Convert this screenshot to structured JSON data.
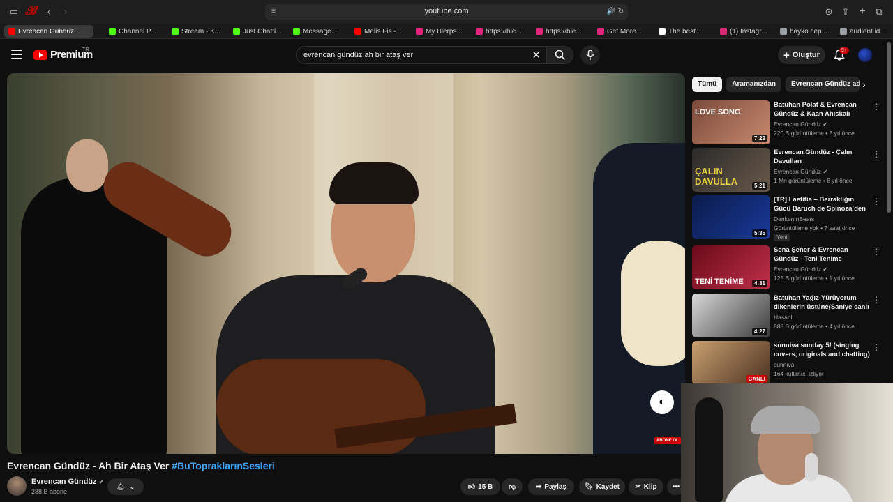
{
  "browser": {
    "url": "youtube.com",
    "tabs": [
      {
        "label": "Evrencan Gündüz...",
        "color": "#ff0000",
        "active": true
      },
      {
        "label": "Channel P...",
        "color": "#53fc18"
      },
      {
        "label": "Stream - K...",
        "color": "#53fc18"
      },
      {
        "label": "Just Chatti...",
        "color": "#53fc18"
      },
      {
        "label": "Message...",
        "color": "#53fc18"
      },
      {
        "label": "Melis Fis -...",
        "color": "#ff0000"
      },
      {
        "label": "My Blerps...",
        "color": "#e0267d"
      },
      {
        "label": "https://ble...",
        "color": "#e0267d"
      },
      {
        "label": "https://ble...",
        "color": "#e0267d"
      },
      {
        "label": "Get More...",
        "color": "#e0267d"
      },
      {
        "label": "The best...",
        "color": "#ffffff"
      },
      {
        "label": "(1) Instagr...",
        "color": "#d62976"
      },
      {
        "label": "hayko cep...",
        "color": "#9aa0a6"
      },
      {
        "label": "audient id...",
        "color": "#9aa0a6"
      }
    ]
  },
  "header": {
    "logo_text": "Premium",
    "logo_region": "TR",
    "search_value": "evrencan gündüz ah bir ataş ver",
    "create_label": "Oluştur",
    "notif_count": "9+"
  },
  "video": {
    "title_main": "Evrencan Gündüz - Ah Bir Ataş Ver ",
    "title_hashtag": "#BuTopraklarınSesleri",
    "overlay_sub": "ABONE OL",
    "channel_name": "Evrencan Gündüz",
    "subscribers": "288 B abone",
    "likes": "15 B",
    "share_label": "Paylaş",
    "save_label": "Kaydet",
    "clip_label": "Klip"
  },
  "chips": [
    "Tümü",
    "Aramanızdan",
    "Evrencan Gündüz adlı yü"
  ],
  "recommendations": [
    {
      "title": "Batuhan Polat & Evrencan Gündüz & Kaan Ahıskalı - Love ...",
      "channel": "Evrencan Gündüz",
      "verified": true,
      "meta": "220 B görüntüleme • 5 yıl önce",
      "duration": "7:29",
      "thumb_text": "LOVE SONG",
      "thumb_colors": [
        "#7a4a3a",
        "#c98a70"
      ]
    },
    {
      "title": "Evrencan Gündüz - Çalın Davulları",
      "channel": "Evrencan Gündüz",
      "verified": true,
      "meta": "1 Mn görüntüleme • 8 yıl önce",
      "duration": "5:21",
      "thumb_text": "ÇALIN DAVULLA",
      "thumb_colors": [
        "#2a2a2a",
        "#6a5a4a"
      ]
    },
    {
      "title": "[TR] Laetitia – Berraklığın Gücü Baruch de Spinoza’den ilhamla ...",
      "channel": "DenkenInBeats",
      "verified": false,
      "meta": "Görüntüleme yok • 7 saat önce",
      "duration": "5:35",
      "thumb_text": "",
      "badge": "Yeni",
      "thumb_colors": [
        "#0a1a4a",
        "#1a3a9a"
      ]
    },
    {
      "title": "Sena Şener & Evrencan Gündüz - Teni Tenime @KupsMedya",
      "channel": "Evrencan Gündüz",
      "verified": true,
      "meta": "125 B görüntüleme • 1 yıl önce",
      "duration": "4:31",
      "thumb_text": "TENİ TENİME",
      "thumb_colors": [
        "#6a0a1a",
        "#c0304a"
      ]
    },
    {
      "title": "Batuhan Yağız-Yürüyorum dikenlerin üstüne(Saniye canlı ...",
      "channel": "Hasanli",
      "verified": false,
      "meta": "888 B görüntüleme • 4 yıl önce",
      "duration": "4:27",
      "thumb_text": "",
      "thumb_colors": [
        "#d8d8d8",
        "#3a3a3a"
      ]
    },
    {
      "title": "sunniva sunday 5! (singing covers, originals and chatting)",
      "channel": "sunniva",
      "verified": false,
      "meta": "164 kullanıcı izliyor",
      "live": "CANLI",
      "thumb_text": "",
      "thumb_colors": [
        "#c9a070",
        "#4a3020"
      ]
    }
  ]
}
